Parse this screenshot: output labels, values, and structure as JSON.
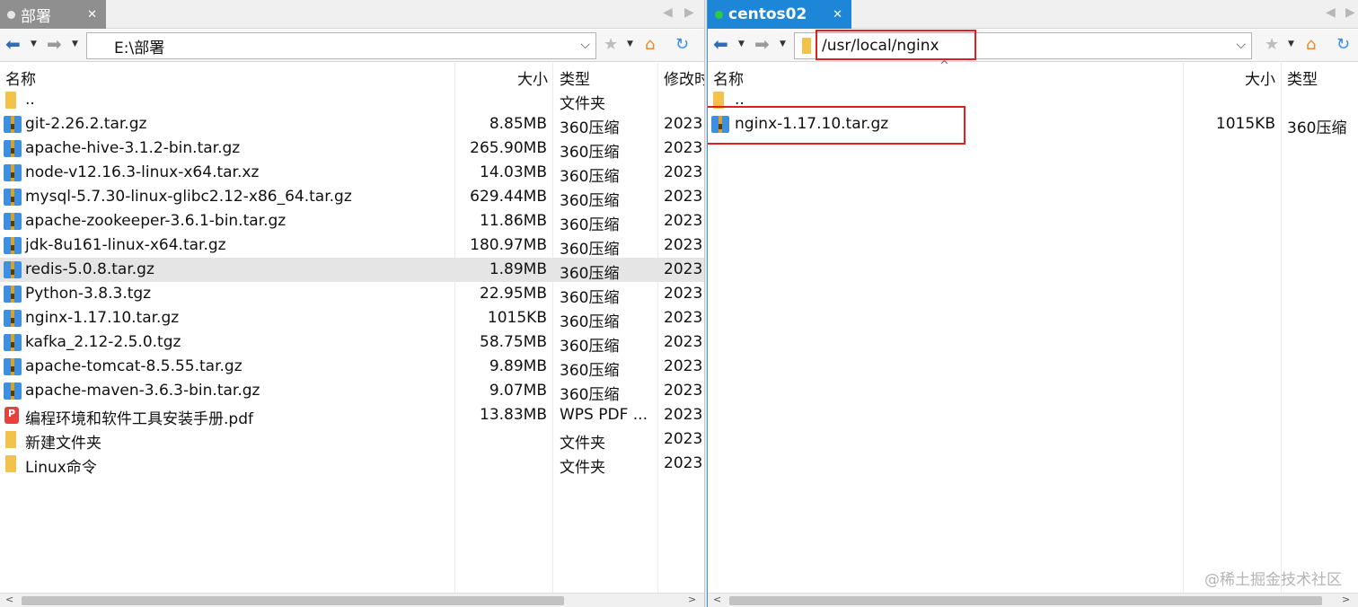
{
  "left_pane": {
    "tab": {
      "title": "部署",
      "dot_color": "#e6e6e6"
    },
    "address": "E:\\部署",
    "columns": [
      "名称",
      "大小",
      "类型",
      "修改时"
    ],
    "rows": [
      {
        "name": "..",
        "size": "",
        "type": "文件夹",
        "date": "",
        "icon": "folder-icon"
      },
      {
        "name": "git-2.26.2.tar.gz",
        "size": "8.85MB",
        "type": "360压缩",
        "date": "2023",
        "icon": "archive-icon"
      },
      {
        "name": "apache-hive-3.1.2-bin.tar.gz",
        "size": "265.90MB",
        "type": "360压缩",
        "date": "2023",
        "icon": "archive-icon"
      },
      {
        "name": "node-v12.16.3-linux-x64.tar.xz",
        "size": "14.03MB",
        "type": "360压缩",
        "date": "2023",
        "icon": "archive-icon"
      },
      {
        "name": "mysql-5.7.30-linux-glibc2.12-x86_64.tar.gz",
        "size": "629.44MB",
        "type": "360压缩",
        "date": "2023",
        "icon": "archive-icon"
      },
      {
        "name": "apache-zookeeper-3.6.1-bin.tar.gz",
        "size": "11.86MB",
        "type": "360压缩",
        "date": "2023",
        "icon": "archive-icon"
      },
      {
        "name": "jdk-8u161-linux-x64.tar.gz",
        "size": "180.97MB",
        "type": "360压缩",
        "date": "2023",
        "icon": "archive-icon"
      },
      {
        "name": "redis-5.0.8.tar.gz",
        "size": "1.89MB",
        "type": "360压缩",
        "date": "2023",
        "icon": "archive-icon",
        "selected": true
      },
      {
        "name": "Python-3.8.3.tgz",
        "size": "22.95MB",
        "type": "360压缩",
        "date": "2023",
        "icon": "archive-icon"
      },
      {
        "name": "nginx-1.17.10.tar.gz",
        "size": "1015KB",
        "type": "360压缩",
        "date": "2023",
        "icon": "archive-icon"
      },
      {
        "name": "kafka_2.12-2.5.0.tgz",
        "size": "58.75MB",
        "type": "360压缩",
        "date": "2023",
        "icon": "archive-icon"
      },
      {
        "name": "apache-tomcat-8.5.55.tar.gz",
        "size": "9.89MB",
        "type": "360压缩",
        "date": "2023",
        "icon": "archive-icon"
      },
      {
        "name": "apache-maven-3.6.3-bin.tar.gz",
        "size": "9.07MB",
        "type": "360压缩",
        "date": "2023",
        "icon": "archive-icon"
      },
      {
        "name": "编程环境和软件工具安装手册.pdf",
        "size": "13.83MB",
        "type": "WPS PDF ...",
        "date": "2023",
        "icon": "pdf-icon"
      },
      {
        "name": "新建文件夹",
        "size": "",
        "type": "文件夹",
        "date": "2023",
        "icon": "folder-icon"
      },
      {
        "name": "Linux命令",
        "size": "",
        "type": "文件夹",
        "date": "2023",
        "icon": "folder-icon"
      }
    ]
  },
  "right_pane": {
    "tab": {
      "title": "centos02",
      "dot_color": "#2ecc40"
    },
    "address": "/usr/local/nginx",
    "columns": [
      "名称",
      "大小",
      "类型"
    ],
    "rows": [
      {
        "name": "..",
        "size": "",
        "type": "",
        "icon": "folder-icon"
      },
      {
        "name": "nginx-1.17.10.tar.gz",
        "size": "1015KB",
        "type": "360压缩",
        "icon": "archive-icon"
      }
    ]
  },
  "watermark": "@稀土掘金技术社区",
  "colors": {
    "highlight_red": "#e01f1f",
    "tab_active_blue": "#1e86d6",
    "tab_inactive_gray": "#8f8f8f"
  }
}
